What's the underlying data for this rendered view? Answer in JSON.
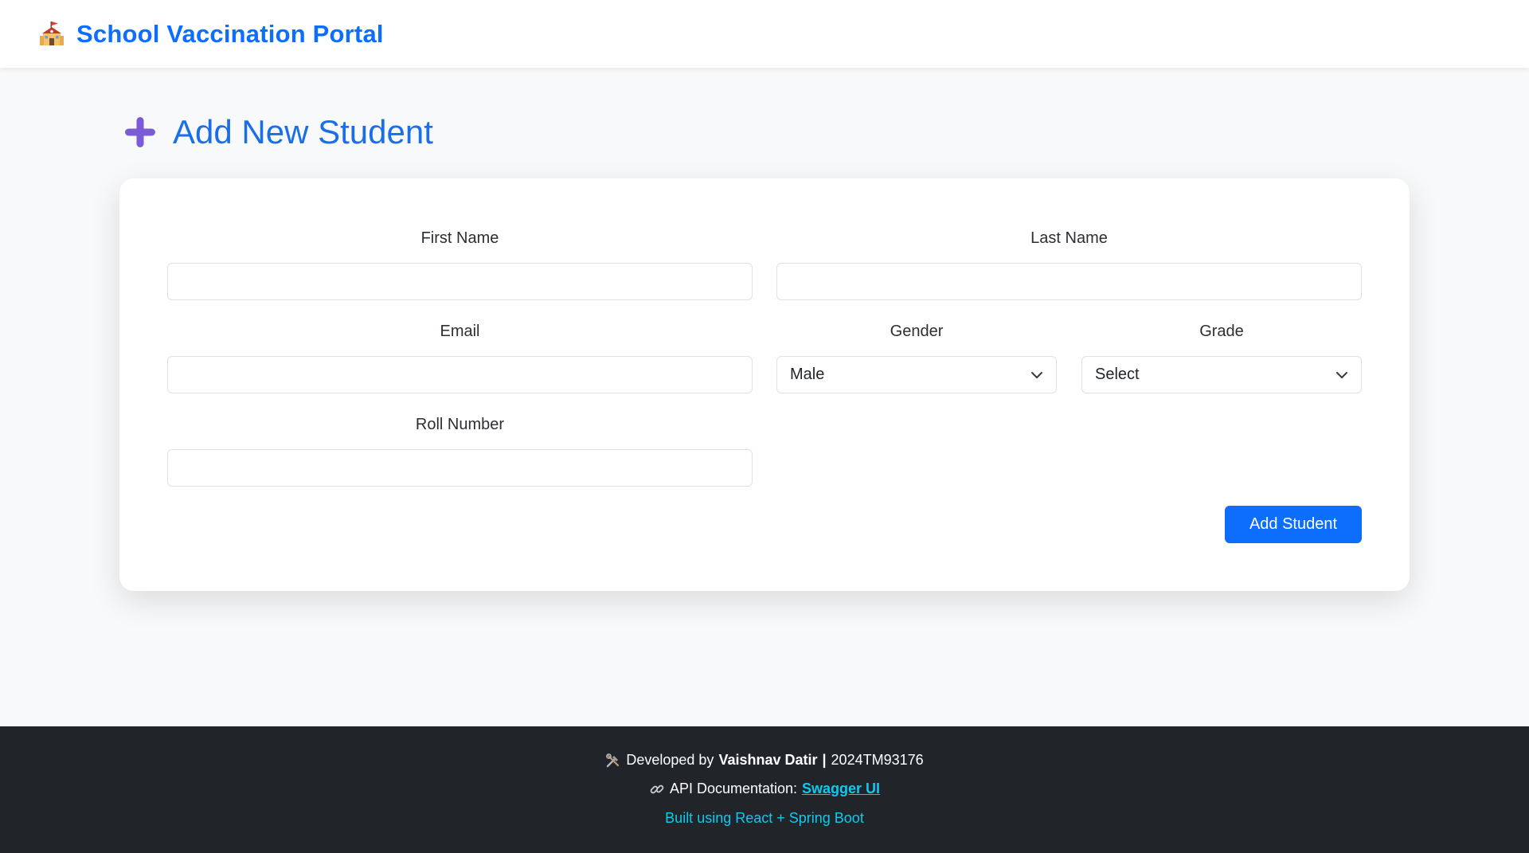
{
  "navbar": {
    "brand_text": "School Vaccination Portal",
    "brand_icon": "school-icon",
    "brand_color": "#0d6efd"
  },
  "page": {
    "title": "Add New Student",
    "title_icon": "plus-icon",
    "accent_color": "#7b5cd6"
  },
  "form": {
    "first_name": {
      "label": "First Name",
      "value": "",
      "placeholder": ""
    },
    "last_name": {
      "label": "Last Name",
      "value": "",
      "placeholder": ""
    },
    "email": {
      "label": "Email",
      "value": "",
      "placeholder": ""
    },
    "gender": {
      "label": "Gender",
      "selected": "Male"
    },
    "grade": {
      "label": "Grade",
      "selected": "Select"
    },
    "roll_number": {
      "label": "Roll Number",
      "value": "",
      "placeholder": ""
    },
    "submit_label": "Add Student",
    "submit_color": "#0d6efd"
  },
  "footer": {
    "developed_prefix": "Developed by",
    "developer_name": "Vaishnav Datir",
    "separator": "|",
    "developer_id": "2024TM93176",
    "api_prefix": "API Documentation:",
    "api_link": "Swagger UI",
    "built_with": "Built using React + Spring Boot",
    "tools_icon": "tools-icon",
    "link_icon": "link-icon",
    "background": "#212529",
    "link_color": "#0dcaf0"
  }
}
